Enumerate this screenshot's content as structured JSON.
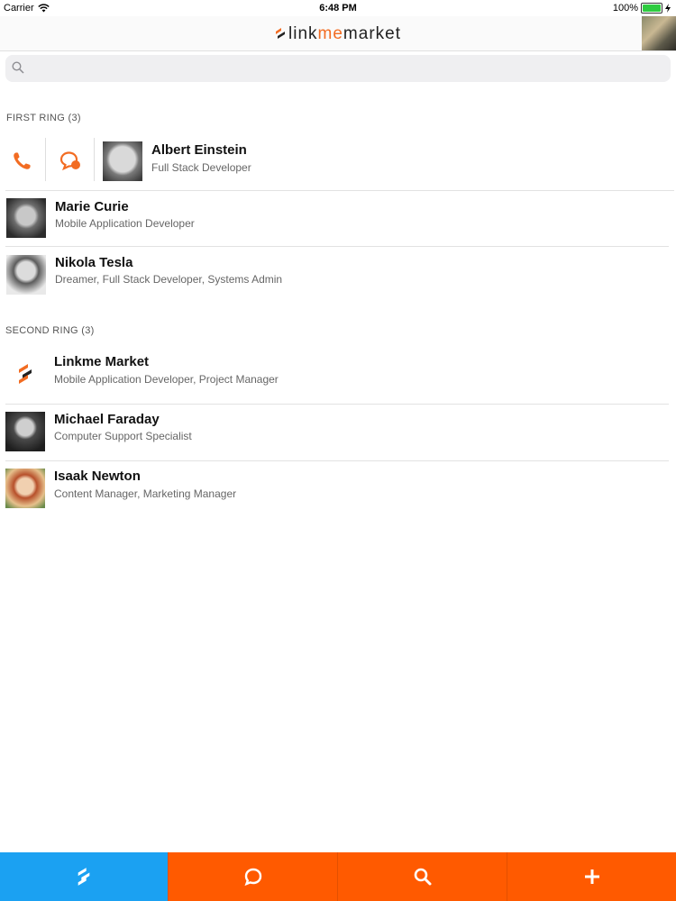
{
  "status_bar": {
    "carrier": "Carrier",
    "time": "6:48 PM",
    "battery": "100%"
  },
  "navbar": {
    "logo_part1": "linkme",
    "logo_part2": "market",
    "logo_accent": "me"
  },
  "search": {
    "placeholder": "",
    "value": ""
  },
  "colors": {
    "accent": "#f26c22",
    "tab_orange": "#ff5a00",
    "tab_blue": "#1ba1f2"
  },
  "sections": [
    {
      "title": "FIRST RING (3)",
      "people": [
        {
          "name": "Albert Einstein",
          "role": "Full Stack Developer",
          "avatar": "einstein-photo"
        },
        {
          "name": "Marie Curie",
          "role": "Mobile Application Developer",
          "avatar": "curie-photo"
        },
        {
          "name": "Nikola Tesla",
          "role": "Dreamer, Full Stack Developer, Systems Admin",
          "avatar": "tesla-photo"
        }
      ]
    },
    {
      "title": "SECOND RING (3)",
      "people": [
        {
          "name": "Linkme Market",
          "role": "Mobile Application Developer, Project Manager",
          "avatar": "linkme-logo"
        },
        {
          "name": "Michael Faraday",
          "role": "Computer Support Specialist",
          "avatar": "faraday-photo"
        },
        {
          "name": "Isaak Newton",
          "role": "Content Manager, Marketing Manager",
          "avatar": "newton-photo"
        }
      ]
    }
  ],
  "row_actions": {
    "call_icon": "phone-icon",
    "chat_icon": "chat-icon"
  },
  "tabbar": {
    "tabs": [
      "linkme-logo-icon",
      "chat-bubble-icon",
      "search-icon",
      "plus-icon"
    ]
  }
}
